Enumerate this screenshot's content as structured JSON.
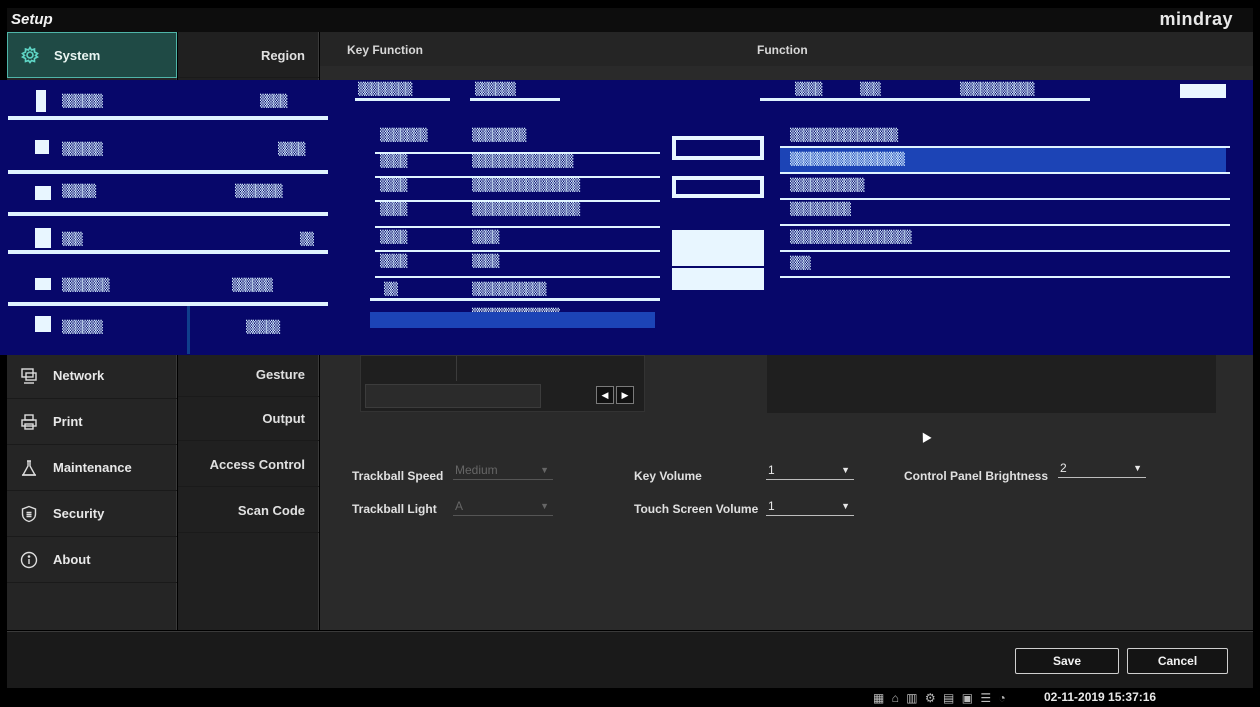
{
  "app": {
    "title": "Setup",
    "brand": "mindray"
  },
  "nav": {
    "items": [
      {
        "label": "System",
        "icon": "gear-icon",
        "active": true
      },
      {
        "label": "Network",
        "icon": "network-icon"
      },
      {
        "label": "Print",
        "icon": "printer-icon"
      },
      {
        "label": "Maintenance",
        "icon": "flask-icon"
      },
      {
        "label": "Security",
        "icon": "shield-icon"
      },
      {
        "label": "About",
        "icon": "info-icon"
      }
    ]
  },
  "subnav": {
    "items": [
      "Region",
      "Gesture",
      "Output",
      "Access Control",
      "Scan Code"
    ]
  },
  "main": {
    "header": {
      "key_function": "Key Function",
      "function": "Function"
    }
  },
  "settings": {
    "trackball_speed": {
      "label": "Trackball Speed",
      "value": "Medium"
    },
    "trackball_light": {
      "label": "Trackball Light",
      "value": "A"
    },
    "key_volume": {
      "label": "Key Volume",
      "value": "1"
    },
    "touch_screen_volume": {
      "label": "Touch Screen Volume",
      "value": "1"
    },
    "control_panel_brightness": {
      "label": "Control Panel Brightness",
      "value": "2"
    }
  },
  "footer": {
    "save": "Save",
    "cancel": "Cancel"
  },
  "status": {
    "datetime": "02-11-2019 15:37:16"
  },
  "colors": {
    "accent": "#4fb5a8",
    "glitch": "#07076a"
  }
}
